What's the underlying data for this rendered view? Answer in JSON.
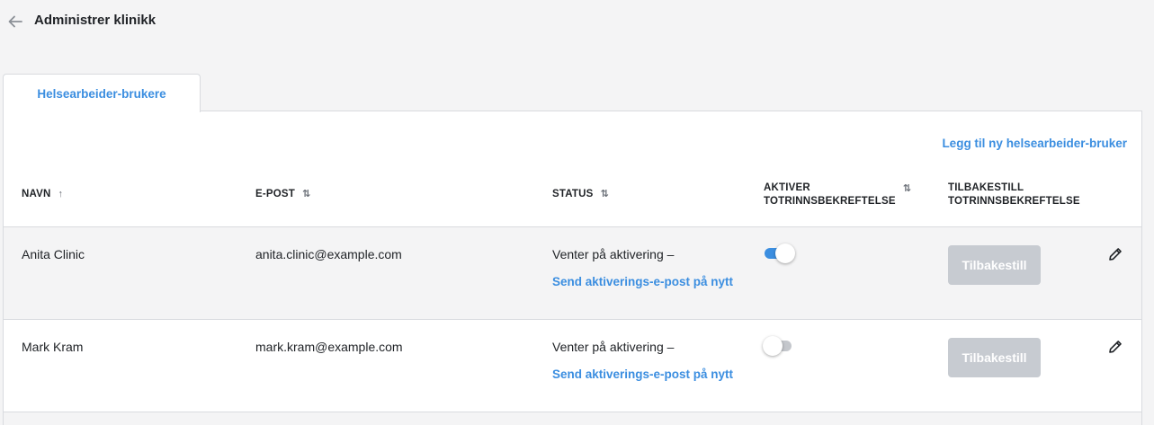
{
  "header": {
    "back_icon": "arrow-left-icon",
    "title": "Administrer klinikk"
  },
  "tabs": [
    {
      "label": "Helsearbeider-brukere",
      "active": true
    }
  ],
  "actions": {
    "add_user_label": "Legg til ny helsearbeider-bruker"
  },
  "table": {
    "columns": [
      {
        "label": "NAVN",
        "sort_icon": "sort-ascending-icon",
        "sort_glyph": "↑"
      },
      {
        "label": "E-POST",
        "sort_icon": "sort-icon",
        "sort_glyph": "⇅"
      },
      {
        "label": "STATUS",
        "sort_icon": "sort-icon",
        "sort_glyph": "⇅"
      },
      {
        "label_line1": "AKTIVER",
        "label_line2": "TOTRINNSBEKREFTELSE",
        "sort_icon": "sort-icon",
        "sort_glyph": "⇅"
      },
      {
        "label_line1": "TILBAKESTILL",
        "label_line2": "TOTRINNSBEKREFTELSE"
      }
    ],
    "rows": [
      {
        "name": "Anita Clinic",
        "email": "anita.clinic@example.com",
        "status": "Venter på aktivering –",
        "resend_label": "Send aktiverings-e-post på nytt",
        "two_factor_enabled": true,
        "reset_label": "Tilbakestill",
        "edit_icon": "pencil-icon"
      },
      {
        "name": "Mark Kram",
        "email": "mark.kram@example.com",
        "status": "Venter på aktivering –",
        "resend_label": "Send aktiverings-e-post på nytt",
        "two_factor_enabled": false,
        "reset_label": "Tilbakestill",
        "edit_icon": "pencil-icon"
      }
    ]
  },
  "colors": {
    "accent": "#3b8ee0",
    "disabled_button": "#c7cbd1",
    "background": "#f4f4f5",
    "text": "#1f2226"
  }
}
